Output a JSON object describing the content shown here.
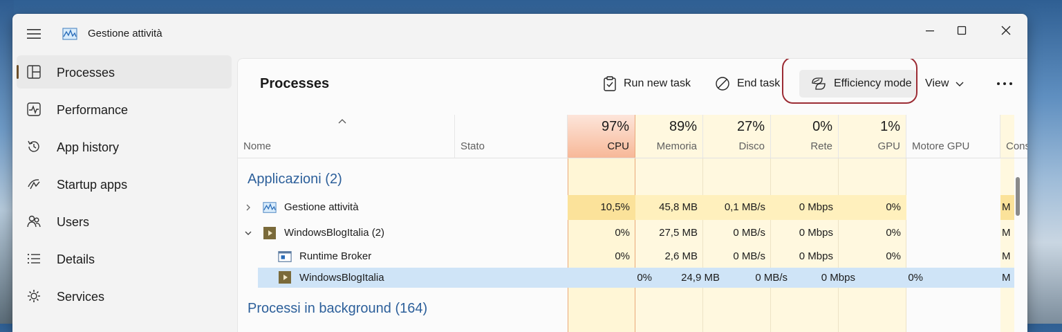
{
  "window": {
    "title": "Gestione attività"
  },
  "sidebar": {
    "items": [
      {
        "label": "Processes",
        "icon": "processes-icon",
        "active": true
      },
      {
        "label": "Performance",
        "icon": "performance-icon"
      },
      {
        "label": "App history",
        "icon": "app-history-icon"
      },
      {
        "label": "Startup apps",
        "icon": "startup-apps-icon"
      },
      {
        "label": "Users",
        "icon": "users-icon"
      },
      {
        "label": "Details",
        "icon": "details-icon"
      },
      {
        "label": "Services",
        "icon": "services-icon"
      }
    ]
  },
  "toolbar": {
    "page_title": "Processes",
    "run_new_task": "Run new task",
    "end_task": "End task",
    "efficiency_mode": "Efficiency mode",
    "view": "View"
  },
  "columns": {
    "name": "Nome",
    "status": "Stato",
    "cpu": {
      "pct": "97%",
      "label": "CPU"
    },
    "memory": {
      "pct": "89%",
      "label": "Memoria"
    },
    "disk": {
      "pct": "27%",
      "label": "Disco"
    },
    "network": {
      "pct": "0%",
      "label": "Rete"
    },
    "gpu": {
      "pct": "1%",
      "label": "GPU"
    },
    "gpu_engine": {
      "label": "Motore GPU"
    },
    "power": {
      "label": "Cons"
    }
  },
  "groups": {
    "apps": "Applicazioni (2)",
    "background": "Processi in background (164)"
  },
  "rows": [
    {
      "name": "Gestione attività",
      "cpu": "10,5%",
      "memory": "45,8 MB",
      "disk": "0,1 MB/s",
      "network": "0 Mbps",
      "gpu": "0%",
      "power": "M"
    },
    {
      "name": "WindowsBlogItalia (2)",
      "cpu": "0%",
      "memory": "27,5 MB",
      "disk": "0 MB/s",
      "network": "0 Mbps",
      "gpu": "0%",
      "power": "M"
    },
    {
      "name": "Runtime Broker",
      "cpu": "0%",
      "memory": "2,6 MB",
      "disk": "0 MB/s",
      "network": "0 Mbps",
      "gpu": "0%",
      "power": "M"
    },
    {
      "name": "WindowsBlogItalia",
      "cpu": "0%",
      "memory": "24,9 MB",
      "disk": "0 MB/s",
      "network": "0 Mbps",
      "gpu": "0%",
      "power": "M"
    }
  ],
  "colors": {
    "cpu_header": "#f9c3a8",
    "cpu_cell_high": "#fbe29a",
    "cell_light": "#fff4c9",
    "column_pale": "#fff9e6",
    "selection": "#cfe4f7",
    "group_text": "#2c5f9a",
    "highlight_ring": "#9b2b33"
  }
}
